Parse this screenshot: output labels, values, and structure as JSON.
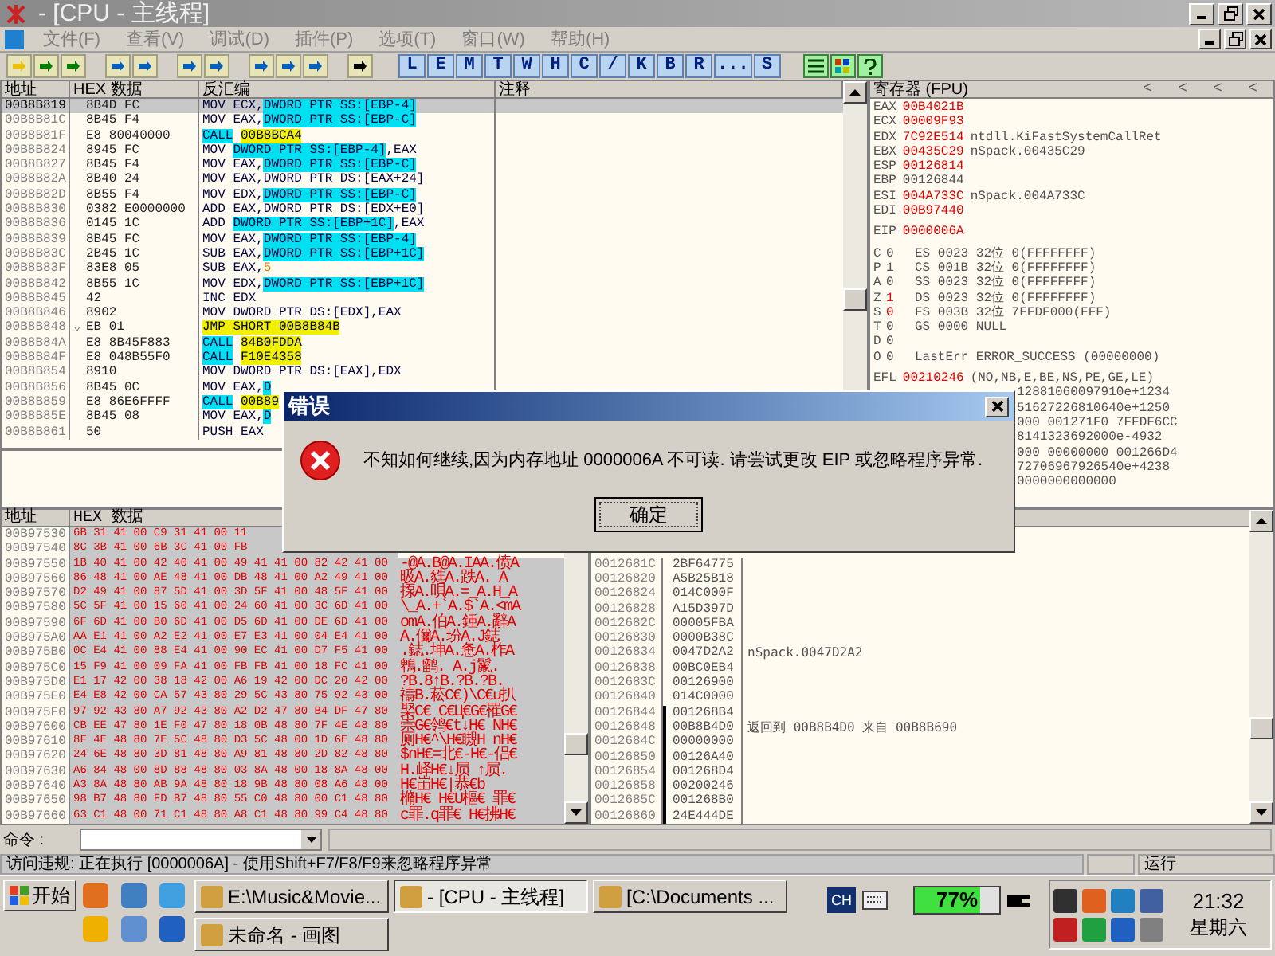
{
  "window": {
    "title": "- [CPU - 主线程]"
  },
  "menu": [
    "文件(F)",
    "查看(V)",
    "调试(D)",
    "插件(P)",
    "选项(T)",
    "窗口(W)",
    "帮助(H)"
  ],
  "toolbar_letters": [
    "L",
    "E",
    "M",
    "T",
    "W",
    "H",
    "C",
    "/",
    "K",
    "B",
    "R",
    "...",
    "S"
  ],
  "disasm": {
    "columns": [
      "地址",
      "HEX 数据",
      "反汇编",
      "注释"
    ],
    "rows": [
      {
        "address": "00B8B819",
        "hex": "8B4D FC",
        "selected": true,
        "code": [
          {
            "kind": "plain",
            "text": "MOV ECX,"
          },
          {
            "kind": "mem",
            "text": "DWORD PTR SS:[EBP-4]"
          }
        ]
      },
      {
        "address": "00B8B81C",
        "hex": "8B45 F4",
        "selected": false,
        "code": [
          {
            "kind": "plain",
            "text": "MOV EAX,"
          },
          {
            "kind": "mem",
            "text": "DWORD PTR SS:[EBP-C]"
          }
        ]
      },
      {
        "address": "00B8B81F",
        "hex": "E8 80040000",
        "selected": false,
        "code": [
          {
            "kind": "mem",
            "text": "CALL"
          },
          {
            "kind": "jump",
            "text": "00B8BCA4"
          }
        ]
      },
      {
        "address": "00B8B824",
        "hex": "8945 FC",
        "selected": false,
        "code": [
          {
            "kind": "plain",
            "text": "MOV "
          },
          {
            "kind": "mem",
            "text": "DWORD PTR SS:[EBP-4]"
          },
          {
            "kind": "plain",
            "text": ",EAX"
          }
        ]
      },
      {
        "address": "00B8B827",
        "hex": "8B45 F4",
        "selected": false,
        "code": [
          {
            "kind": "plain",
            "text": "MOV EAX,"
          },
          {
            "kind": "mem",
            "text": "DWORD PTR SS:[EBP-C]"
          }
        ]
      },
      {
        "address": "00B8B82A",
        "hex": "8B40 24",
        "selected": false,
        "code": [
          {
            "kind": "plain",
            "text": "MOV EAX,DWORD PTR DS:[EAX+24]"
          }
        ]
      },
      {
        "address": "00B8B82D",
        "hex": "8B55 F4",
        "selected": false,
        "code": [
          {
            "kind": "plain",
            "text": "MOV EDX,"
          },
          {
            "kind": "mem",
            "text": "DWORD PTR SS:[EBP-C]"
          }
        ]
      },
      {
        "address": "00B8B830",
        "hex": "0382 E0000000",
        "selected": false,
        "code": [
          {
            "kind": "plain",
            "text": "ADD EAX,DWORD PTR DS:[EDX+E0]"
          }
        ]
      },
      {
        "address": "00B8B836",
        "hex": "0145 1C",
        "selected": false,
        "code": [
          {
            "kind": "plain",
            "text": "ADD "
          },
          {
            "kind": "mem",
            "text": "DWORD PTR SS:[EBP+1C]"
          },
          {
            "kind": "plain",
            "text": ",EAX"
          }
        ]
      },
      {
        "address": "00B8B839",
        "hex": "8B45 FC",
        "selected": false,
        "code": [
          {
            "kind": "plain",
            "text": "MOV EAX,"
          },
          {
            "kind": "mem",
            "text": "DWORD PTR SS:[EBP-4]"
          }
        ]
      },
      {
        "address": "00B8B83C",
        "hex": "2B45 1C",
        "selected": false,
        "code": [
          {
            "kind": "plain",
            "text": "SUB EAX,"
          },
          {
            "kind": "mem",
            "text": "DWORD PTR SS:[EBP+1C]"
          }
        ]
      },
      {
        "address": "00B8B83F",
        "hex": "83E8 05",
        "selected": false,
        "code": [
          {
            "kind": "plain",
            "text": "SUB EAX,"
          },
          {
            "kind": "const",
            "text": "5"
          }
        ]
      },
      {
        "address": "00B8B842",
        "hex": "8B55 1C",
        "selected": false,
        "code": [
          {
            "kind": "plain",
            "text": "MOV EDX,"
          },
          {
            "kind": "mem",
            "text": "DWORD PTR SS:[EBP+1C]"
          }
        ]
      },
      {
        "address": "00B8B845",
        "hex": "42",
        "selected": false,
        "code": [
          {
            "kind": "plain",
            "text": "INC EDX"
          }
        ]
      },
      {
        "address": "00B8B846",
        "hex": "8902",
        "selected": false,
        "code": [
          {
            "kind": "plain",
            "text": "MOV DWORD PTR DS:[EDX],EAX"
          }
        ]
      },
      {
        "address": "00B8B848",
        "hex": "EB 01",
        "marker": "⌄",
        "selected": false,
        "code": [
          {
            "kind": "jump",
            "text": "JMP SHORT 00B8B84B"
          }
        ]
      },
      {
        "address": "00B8B84A",
        "hex": "E8 8B45F883",
        "selected": false,
        "code": [
          {
            "kind": "mem",
            "text": "CALL"
          },
          {
            "kind": "jump",
            "text": "84B0FDDA"
          }
        ]
      },
      {
        "address": "00B8B84F",
        "hex": "E8 048B55F0",
        "selected": false,
        "code": [
          {
            "kind": "mem",
            "text": "CALL"
          },
          {
            "kind": "jump",
            "text": "F10E4358"
          }
        ]
      },
      {
        "address": "00B8B854",
        "hex": "8910",
        "selected": false,
        "code": [
          {
            "kind": "plain",
            "text": "MOV DWORD PTR DS:[EAX],EDX"
          }
        ]
      },
      {
        "address": "00B8B856",
        "hex": "8B45 0C",
        "selected": false,
        "code": [
          {
            "kind": "plain",
            "text": "MOV EAX,"
          },
          {
            "kind": "mem",
            "text": "D"
          }
        ]
      },
      {
        "address": "00B8B859",
        "hex": "E8 86E6FFFF",
        "selected": false,
        "code": [
          {
            "kind": "mem",
            "text": "CALL"
          },
          {
            "kind": "jump",
            "text": "00B89"
          }
        ]
      },
      {
        "address": "00B8B85E",
        "hex": "8B45 08",
        "selected": false,
        "code": [
          {
            "kind": "plain",
            "text": "MOV EAX,"
          },
          {
            "kind": "mem",
            "text": "D"
          }
        ]
      },
      {
        "address": "00B8B861",
        "hex": "50",
        "selected": false,
        "code": [
          {
            "kind": "plain",
            "text": "PUSH EAX"
          }
        ]
      }
    ]
  },
  "registers": {
    "title": "寄存器 (FPU)",
    "nav": [
      "<",
      "<",
      "<",
      "<"
    ],
    "general": [
      {
        "name": "EAX",
        "value": "00B4021B",
        "changed": true
      },
      {
        "name": "ECX",
        "value": "00009F93",
        "changed": true
      },
      {
        "name": "EDX",
        "value": "7C92E514",
        "changed": true,
        "comment": "ntdll.KiFastSystemCallRet"
      },
      {
        "name": "EBX",
        "value": "00435C29",
        "changed": true,
        "comment": "nSpack.00435C29"
      },
      {
        "name": "ESP",
        "value": "00126814",
        "changed": true
      },
      {
        "name": "EBP",
        "value": "00126844",
        "changed": false
      },
      {
        "name": "ESI",
        "value": "004A733C",
        "changed": true,
        "comment": "nSpack.004A733C"
      },
      {
        "name": "EDI",
        "value": "00B97440",
        "changed": true
      }
    ],
    "eip": {
      "name": "EIP",
      "value": "0000006A",
      "changed": true
    },
    "flags": [
      {
        "flag": "C",
        "bit": "0",
        "changed": false,
        "segment": "ES 0023 32位 0(FFFFFFFF)"
      },
      {
        "flag": "P",
        "bit": "1",
        "changed": false,
        "segment": "CS 001B 32位 0(FFFFFFFF)"
      },
      {
        "flag": "A",
        "bit": "0",
        "changed": false,
        "segment": "SS 0023 32位 0(FFFFFFFF)"
      },
      {
        "flag": "Z",
        "bit": "1",
        "changed": true,
        "segment": "DS 0023 32位 0(FFFFFFFF)"
      },
      {
        "flag": "S",
        "bit": "0",
        "changed": true,
        "segment": "FS 003B 32位 7FFDF000(FFF)"
      },
      {
        "flag": "T",
        "bit": "0",
        "changed": false,
        "segment": "GS 0000 NULL"
      },
      {
        "flag": "D",
        "bit": "0",
        "changed": false
      },
      {
        "flag": "O",
        "bit": "0",
        "changed": false,
        "segment": "LastErr ERROR_SUCCESS (00000000)"
      }
    ],
    "efl": {
      "name": "EFL",
      "value": "00210246",
      "changed": true,
      "comment": "(NO,NB,E,BE,NS,PE,GE,LE)"
    },
    "fpu_fragments": [
      "12881060097910e+1234",
      "51627226810640e+1250",
      "000 001271F0 7FFDF6CC",
      "8141323692000e-4932",
      "000 00000000 001266D4",
      "72706967926540e+4238",
      "0000000000000"
    ]
  },
  "dump": {
    "columns": [
      "地址",
      "HEX 数据"
    ],
    "rows": [
      {
        "address": "00B97530",
        "hex": "6B 31 41 00 C9 31 41 00 11",
        "selected": true
      },
      {
        "address": "00B97540",
        "hex": "8C 3B 41 00 6B 3C 41 00 FB",
        "selected": true
      },
      {
        "address": "00B97550",
        "hex": "1B 40 41 00 42 40 41 00 49 41 41 00 82 42 41 00",
        "ascii": "-@A.B@A.IAA.偾A",
        "selected": true
      },
      {
        "address": "00B97560",
        "hex": "86 48 41 00 AE 48 41 00 DB 48 41 00 A2 49 41 00",
        "ascii": "昅A.甤A.跌A. A",
        "selected": true
      },
      {
        "address": "00B97570",
        "hex": "D2 49 41 00 87 5D 41 00 3D 5F 41 00 48 5F 41 00",
        "ascii": "揼A.唄A.=_A.H_A",
        "selected": true
      },
      {
        "address": "00B97580",
        "hex": "5C 5F 41 00 15 60 41 00 24 60 41 00 3C 6D 41 00",
        "ascii": "\\_A.+`A.$`A.<mA",
        "selected": true
      },
      {
        "address": "00B97590",
        "hex": "6F 6D 41 00 B0 6D 41 00 D5 6D 41 00 DE 6D 41 00",
        "ascii": "omA.伯A.鍾A.辭A",
        "selected": true
      },
      {
        "address": "00B975A0",
        "hex": "AA E1 41 00 A2 E2 41 00 E7 E3 41 00 04 E4 41 00",
        "ascii": " A.儞A.玢A.J鋕",
        "selected": true
      },
      {
        "address": "00B975B0",
        "hex": "0C E4 41 00 88 E4 41 00 90 EC 41 00 D7 F5 41 00",
        "ascii": ".鋕.坤A.惫A.柞A",
        "selected": true
      },
      {
        "address": "00B975C0",
        "hex": "15 F9 41 00 09 FA 41 00 FB FB 41 00 18 FC 41 00",
        "ascii": "鵯.鹠. A.j鬣.",
        "selected": true
      },
      {
        "address": "00B975D0",
        "hex": "E1 17 42 00 38 18 42 00 A6 19 42 00 DC 20 42 00",
        "ascii": "?B.8↑B.?B.?B.",
        "selected": true
      },
      {
        "address": "00B975E0",
        "hex": "E4 E8 42 00 CA 57 43 80 29 5C 43 80 75 92 43 00",
        "ascii": "禱B.菘C€)\\C€u扒",
        "selected": true
      },
      {
        "address": "00B975F0",
        "hex": "97 92 43 80 A7 92 43 80 A2 D2 47 80 B4 DF 47 80",
        "ascii": "棸C€ C€Ц€G€罹G€",
        "selected": true
      },
      {
        "address": "00B97600",
        "hex": "CB EE 47 80 1E F0 47 80 18 0B 48 80 7F 4E 48 80",
        "ascii": "崇G€鸰€t↓H€ NH€",
        "selected": true
      },
      {
        "address": "00B97610",
        "hex": "8F 4E 48 80 7E 5C 48 80 D3 5C 48 00 1D 6E 48 80",
        "ascii": "厕H€^\\H€瞡H nH€",
        "selected": true
      },
      {
        "address": "00B97620",
        "hex": "24 6E 48 80 3D 81 48 80 A9 81 48 80 2D 82 48 80",
        "ascii": "$nH€=北€-H€-侣€",
        "selected": true
      },
      {
        "address": "00B97630",
        "hex": "A6 84 48 00 8D 88 48 80 03 8A 48 00 18 8A 48 00",
        "ascii": " H.峄H€↓屃 ↑屃.",
        "selected": true
      },
      {
        "address": "00B97640",
        "hex": "A3 8A 48 80 AB 9A 48 80 18 9B 48 80 08 A6 48 00",
        "ascii": " H€峀H€|恭€b",
        "selected": true
      },
      {
        "address": "00B97650",
        "hex": "98 B7 48 80 FD B7 48 80 55 C0 48 80 00 C1 48 80",
        "ascii": "樇H€ H€U樞€ 罪€",
        "selected": true
      },
      {
        "address": "00B97660",
        "hex": "63 C1 48 00 71 C1 48 80 A8 C1 48 80 99 C4 48 80",
        "ascii": "c罪.q罪€ H€拂H€",
        "selected": true
      }
    ]
  },
  "stack": {
    "rows": [
      {
        "address": "0012681C",
        "value": "2BF64775",
        "in_frame": false
      },
      {
        "address": "00126820",
        "value": "A5B25B18",
        "in_frame": false
      },
      {
        "address": "00126824",
        "value": "014C000F",
        "in_frame": false
      },
      {
        "address": "00126828",
        "value": "A15D397D",
        "in_frame": false
      },
      {
        "address": "0012682C",
        "value": "00005FBA",
        "in_frame": false
      },
      {
        "address": "00126830",
        "value": "0000B38C",
        "in_frame": false
      },
      {
        "address": "00126834",
        "value": "0047D2A2",
        "comment": "nSpack.0047D2A2",
        "in_frame": false
      },
      {
        "address": "00126838",
        "value": "00BC0EB4",
        "in_frame": false
      },
      {
        "address": "0012683C",
        "value": "00126900",
        "in_frame": false
      },
      {
        "address": "00126840",
        "value": "014C0000",
        "in_frame": false
      },
      {
        "address": "00126844",
        "value": "001268B4",
        "in_frame": true
      },
      {
        "address": "00126848",
        "value": "00B8B4D0",
        "comment": "返回到 00B8B4D0 来自 00B8B690",
        "in_frame": true
      },
      {
        "address": "0012684C",
        "value": "00000000",
        "in_frame": true
      },
      {
        "address": "00126850",
        "value": "00126A40",
        "in_frame": true
      },
      {
        "address": "00126854",
        "value": "001268D4",
        "in_frame": true
      },
      {
        "address": "00126858",
        "value": "00200246",
        "in_frame": true
      },
      {
        "address": "0012685C",
        "value": "001268B0",
        "in_frame": true
      },
      {
        "address": "00126860",
        "value": "24E444DE",
        "in_frame": true
      }
    ]
  },
  "dialog": {
    "title": "错误",
    "message": "不知如何继续,因为内存地址 0000006A 不可读. 请尝试更改 EIP 或忽略程序异常.",
    "button": "确定"
  },
  "command_bar": {
    "label": "命令 :"
  },
  "status_bar": {
    "message": "访问违规: 正在执行 [0000006A] - 使用Shift+F7/F8/F9来忽略程序异常",
    "state": "运行"
  },
  "taskbar": {
    "start": "开始",
    "tasks": [
      {
        "label": "E:\\Music&Movie...",
        "selected": false
      },
      {
        "label": "- [CPU - 主线程]",
        "selected": true
      },
      {
        "label": "[C:\\Documents ...",
        "selected": false
      },
      {
        "label": "未命名 - 画图",
        "selected": false
      }
    ],
    "input_method": "CH",
    "battery": {
      "text": "77%",
      "level": 0.77
    },
    "time": "21:32",
    "day": "星期六"
  }
}
